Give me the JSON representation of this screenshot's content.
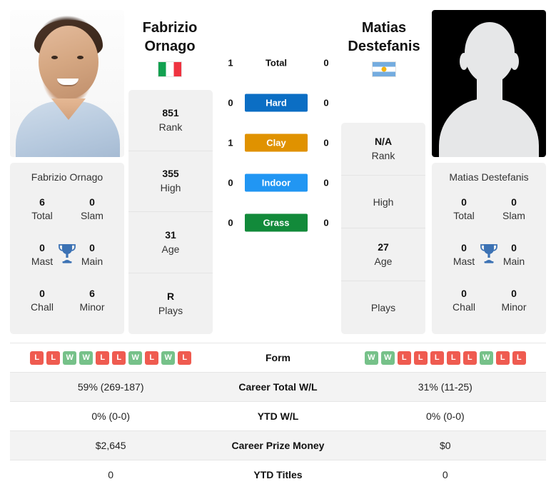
{
  "players": {
    "left": {
      "first_name": "Fabrizio",
      "last_name": "Ornago",
      "full_name": "Fabrizio Ornago",
      "country": "Italy",
      "flag_icon": "flag-italy-icon",
      "photo_kind": "player-photo",
      "rank": "851",
      "rank_label": "Rank",
      "high": "355",
      "high_label": "High",
      "age": "31",
      "age_label": "Age",
      "plays": "R",
      "plays_label": "Plays",
      "titles": {
        "total": "6",
        "total_label": "Total",
        "slam": "0",
        "slam_label": "Slam",
        "mast": "0",
        "mast_label": "Mast",
        "main": "0",
        "main_label": "Main",
        "chall": "0",
        "chall_label": "Chall",
        "minor": "6",
        "minor_label": "Minor"
      },
      "form": [
        "L",
        "L",
        "W",
        "W",
        "L",
        "L",
        "W",
        "L",
        "W",
        "L"
      ],
      "career_total_wl": "59% (269-187)",
      "ytd_wl": "0% (0-0)",
      "career_prize_money": "$2,645",
      "ytd_titles": "0"
    },
    "right": {
      "first_name": "Matias",
      "last_name": "Destefanis",
      "full_name": "Matias Destefanis",
      "country": "Argentina",
      "flag_icon": "flag-argentina-icon",
      "photo_kind": "placeholder-avatar",
      "rank": "N/A",
      "rank_label": "Rank",
      "high": "",
      "high_label": "High",
      "age": "27",
      "age_label": "Age",
      "plays": "",
      "plays_label": "Plays",
      "titles": {
        "total": "0",
        "total_label": "Total",
        "slam": "0",
        "slam_label": "Slam",
        "mast": "0",
        "mast_label": "Mast",
        "main": "0",
        "main_label": "Main",
        "chall": "0",
        "chall_label": "Chall",
        "minor": "0",
        "minor_label": "Minor"
      },
      "form": [
        "W",
        "W",
        "L",
        "L",
        "L",
        "L",
        "L",
        "W",
        "L",
        "L"
      ],
      "career_total_wl": "31% (11-25)",
      "ytd_wl": "0% (0-0)",
      "career_prize_money": "$0",
      "ytd_titles": "0"
    }
  },
  "head_to_head": {
    "rows": [
      {
        "label": "Total",
        "left": "1",
        "right": "0",
        "color": "",
        "badge": false
      },
      {
        "label": "Hard",
        "left": "0",
        "right": "0",
        "color": "#0b6ec4",
        "badge": true
      },
      {
        "label": "Clay",
        "left": "1",
        "right": "0",
        "color": "#e09200",
        "badge": true
      },
      {
        "label": "Indoor",
        "left": "0",
        "right": "0",
        "color": "#2196f3",
        "badge": true
      },
      {
        "label": "Grass",
        "left": "0",
        "right": "0",
        "color": "#128a3a",
        "badge": true
      }
    ]
  },
  "compare_table": {
    "rows": [
      {
        "label": "Form",
        "left": "",
        "right": "",
        "type": "form"
      },
      {
        "label": "Career Total W/L",
        "left": "59% (269-187)",
        "right": "31% (11-25)",
        "type": "text"
      },
      {
        "label": "YTD W/L",
        "left": "0% (0-0)",
        "right": "0% (0-0)",
        "type": "text"
      },
      {
        "label": "Career Prize Money",
        "left": "$2,645",
        "right": "$0",
        "type": "text"
      },
      {
        "label": "YTD Titles",
        "left": "0",
        "right": "0",
        "type": "text"
      }
    ]
  },
  "colors": {
    "hard": "#0b6ec4",
    "clay": "#e09200",
    "indoor": "#2196f3",
    "grass": "#128a3a",
    "win": "#76c189",
    "loss": "#ef5b50",
    "card_bg": "#f1f1f1",
    "trophy": "#3c72b4"
  }
}
